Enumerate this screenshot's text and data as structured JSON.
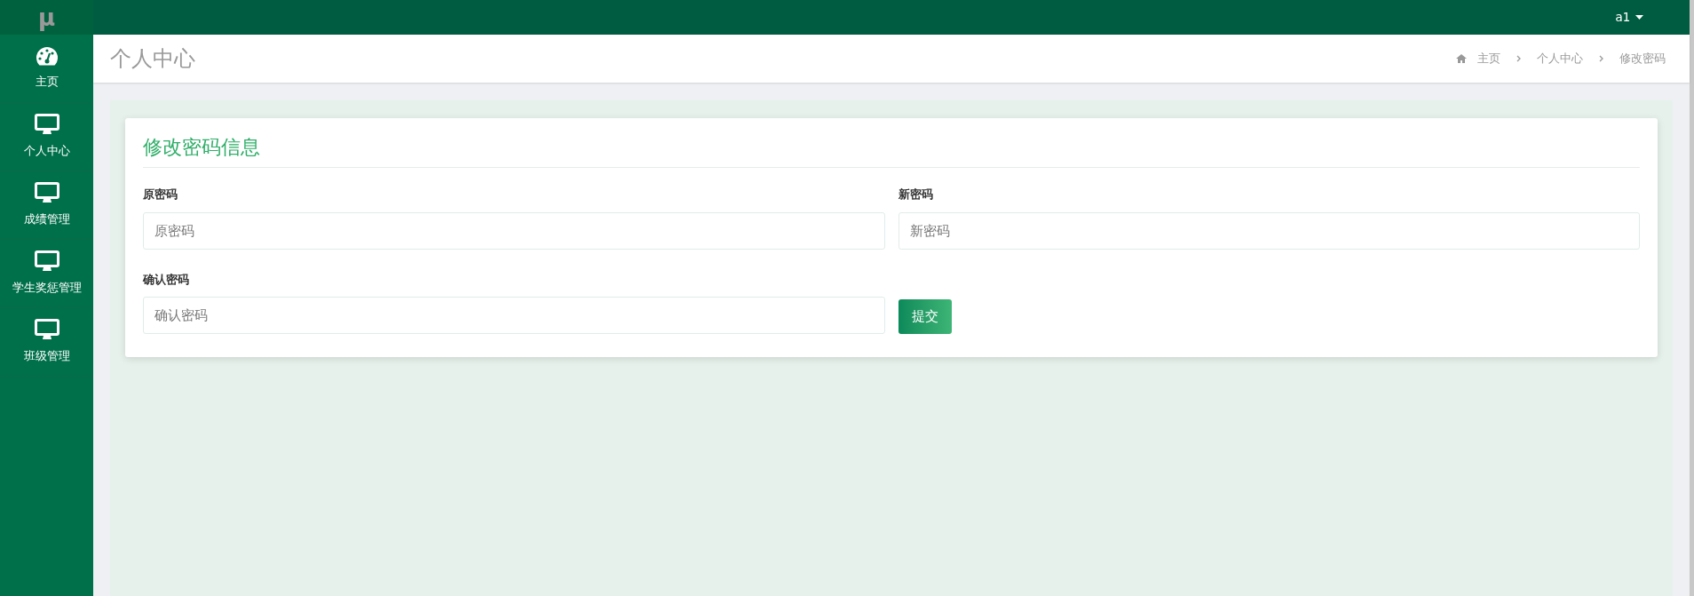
{
  "logo": "μ",
  "user_menu": {
    "label": "a1"
  },
  "sidebar": {
    "items": [
      {
        "label": "主页",
        "kind": "dashboard"
      },
      {
        "label": "个人中心",
        "kind": "monitor"
      },
      {
        "label": "成绩管理",
        "kind": "monitor"
      },
      {
        "label": "学生奖惩管理",
        "kind": "monitor"
      },
      {
        "label": "班级管理",
        "kind": "monitor"
      }
    ]
  },
  "page_title": "个人中心",
  "breadcrumb": [
    "主页",
    "个人中心",
    "修改密码"
  ],
  "form": {
    "title": "修改密码信息",
    "fields": [
      {
        "label": "原密码",
        "placeholder": "原密码"
      },
      {
        "label": "新密码",
        "placeholder": "新密码"
      },
      {
        "label": "确认密码",
        "placeholder": "确认密码"
      }
    ],
    "submit": "提交"
  }
}
